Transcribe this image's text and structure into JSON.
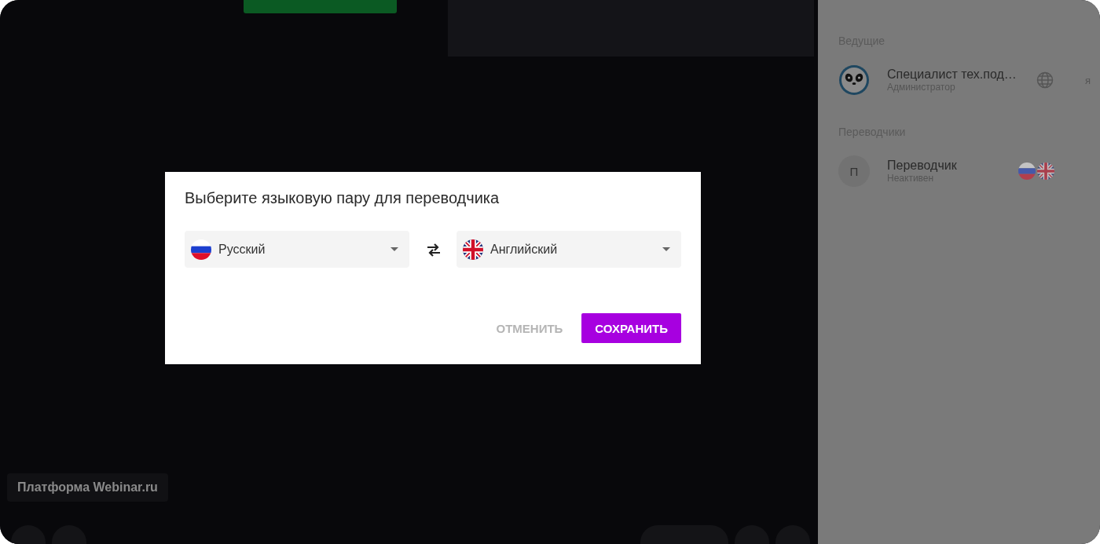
{
  "dialog": {
    "title": "Выберите языковую пару для переводчика",
    "languages": [
      {
        "label": "Русский",
        "kind": "ru"
      },
      {
        "label": "Английский",
        "kind": "gb"
      }
    ],
    "buttons": [
      {
        "label": "ОТМЕНИТЬ",
        "kind": "secondary"
      },
      {
        "label": "СОХРАНИТЬ",
        "kind": "primary"
      }
    ]
  },
  "platform_label": "Платформа Webinar.ru",
  "participants": [
    {
      "title": "Ведущие",
      "members": [
        {
          "name": "Специалист тех.под…",
          "role": "Администратор",
          "kind": "host",
          "self_label": "я"
        }
      ]
    },
    {
      "title": "Переводчики",
      "members": [
        {
          "name": "Переводчик",
          "role": "Неактивен",
          "kind": "translator",
          "initial": "П",
          "flags": [
            {
              "kind": "ru"
            },
            {
              "kind": "gb"
            }
          ]
        }
      ]
    }
  ]
}
